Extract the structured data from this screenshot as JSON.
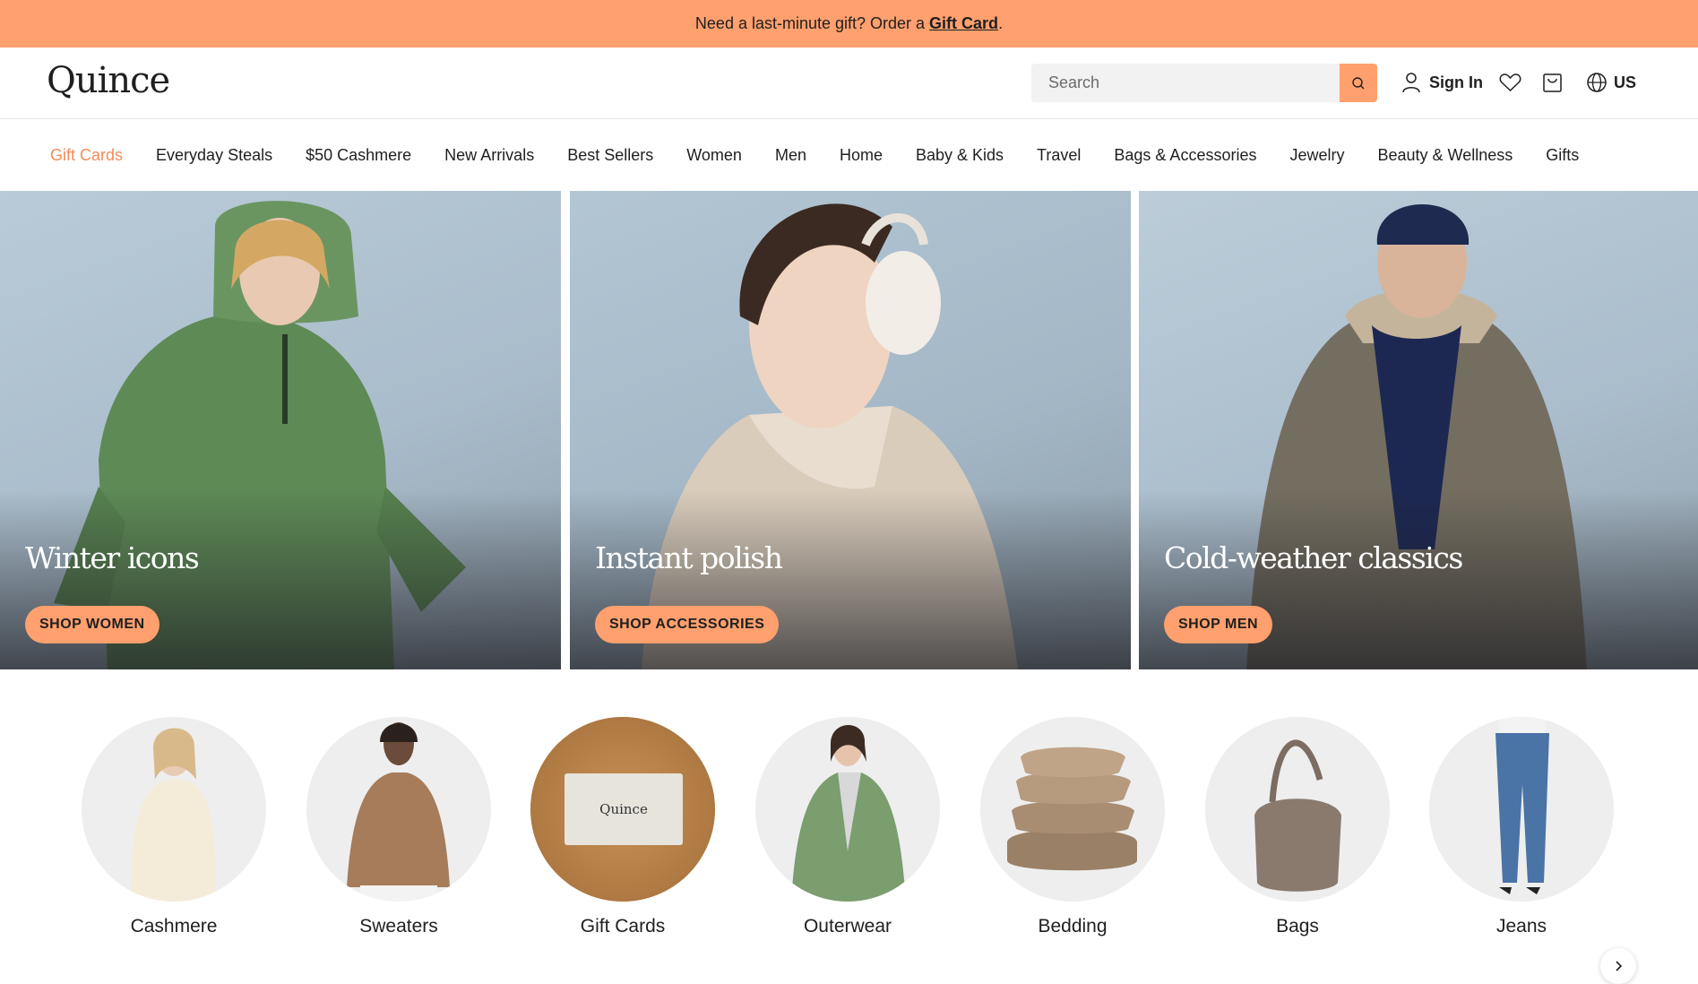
{
  "announcement": {
    "text": "Need a last-minute gift? Order a",
    "link": "Gift Card",
    "suffix": "."
  },
  "header": {
    "logo": "Quince",
    "search_placeholder": "Search",
    "sign_in": "Sign In",
    "region": "US"
  },
  "nav": [
    {
      "label": "Gift Cards",
      "active": true
    },
    {
      "label": "Everyday Steals"
    },
    {
      "label": "$50 Cashmere"
    },
    {
      "label": "New Arrivals"
    },
    {
      "label": "Best Sellers"
    },
    {
      "label": "Women"
    },
    {
      "label": "Men"
    },
    {
      "label": "Home"
    },
    {
      "label": "Baby & Kids"
    },
    {
      "label": "Travel"
    },
    {
      "label": "Bags & Accessories"
    },
    {
      "label": "Jewelry"
    },
    {
      "label": "Beauty & Wellness"
    },
    {
      "label": "Gifts"
    }
  ],
  "heroes": [
    {
      "title": "Winter icons",
      "cta": "SHOP WOMEN"
    },
    {
      "title": "Instant polish",
      "cta": "SHOP ACCESSORIES"
    },
    {
      "title": "Cold-weather classics",
      "cta": "SHOP MEN"
    }
  ],
  "categories": [
    {
      "label": "Cashmere"
    },
    {
      "label": "Sweaters"
    },
    {
      "label": "Gift Cards",
      "card_text": "Quince"
    },
    {
      "label": "Outerwear"
    },
    {
      "label": "Bedding"
    },
    {
      "label": "Bags"
    },
    {
      "label": "Jeans"
    }
  ],
  "colors": {
    "accent": "#ffa06e",
    "active_nav": "#f28c5a"
  }
}
